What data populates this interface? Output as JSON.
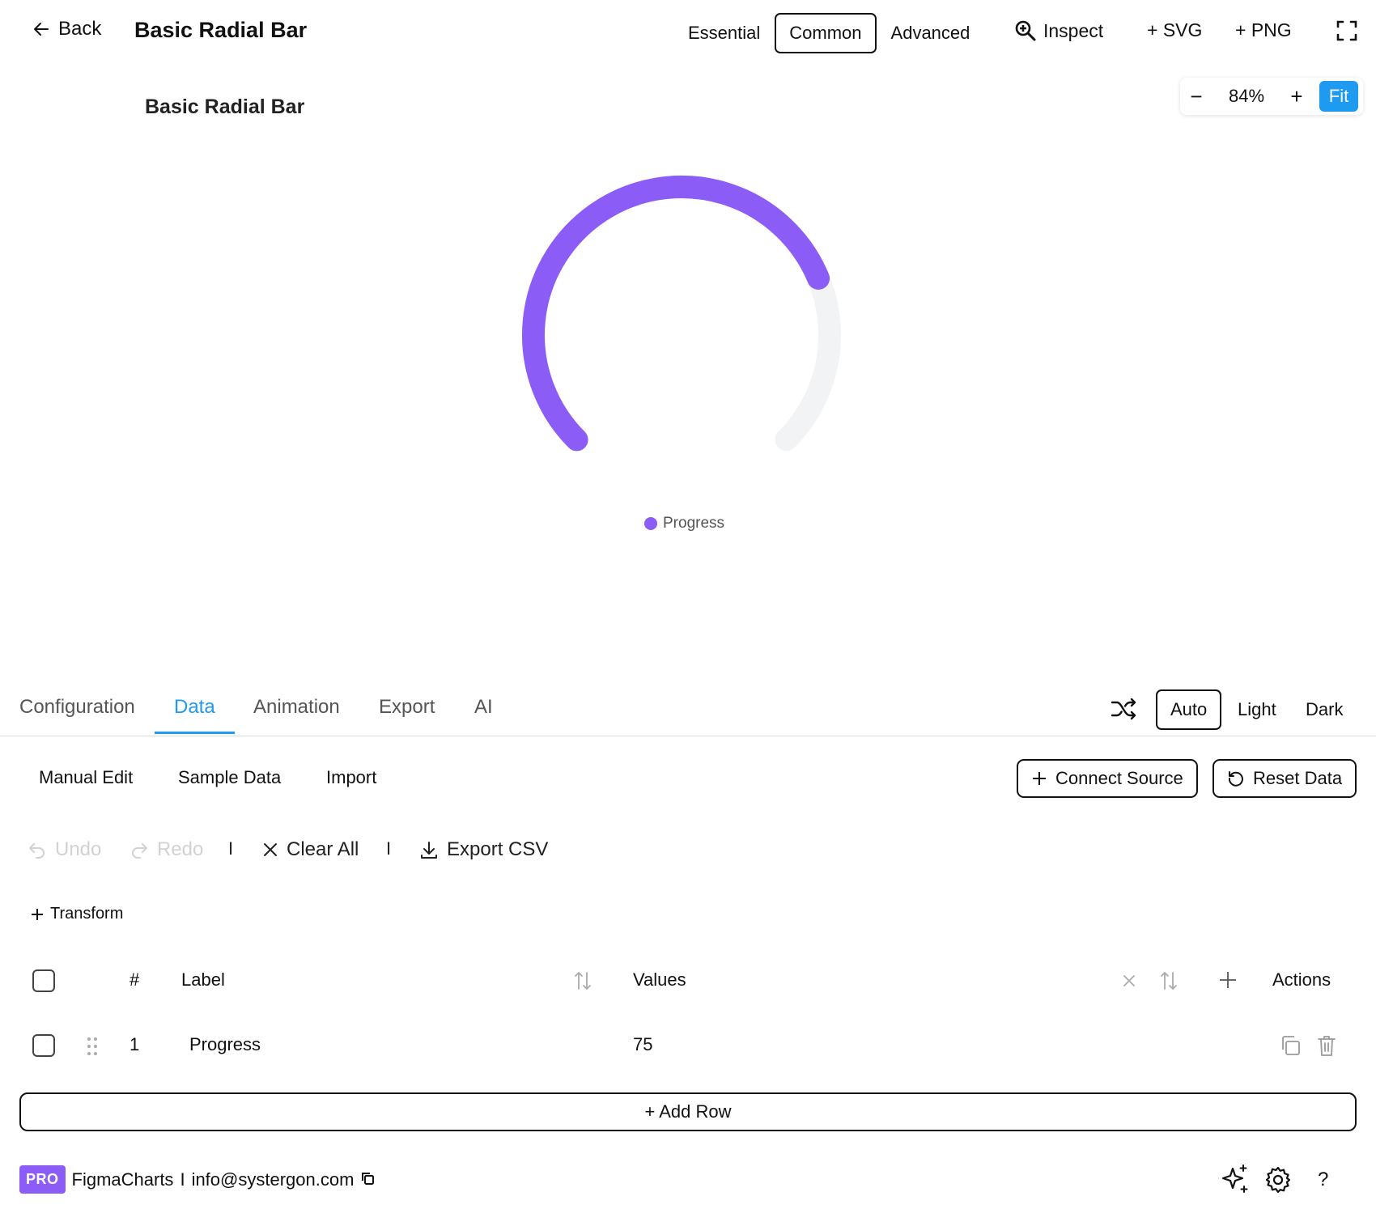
{
  "header": {
    "back_label": "Back",
    "title": "Basic Radial Bar",
    "category_tabs": [
      {
        "label": "Essential",
        "active": false
      },
      {
        "label": "Common",
        "active": true
      },
      {
        "label": "Advanced",
        "active": false
      }
    ],
    "inspect_label": "Inspect",
    "svg_label": "+ SVG",
    "png_label": "+ PNG"
  },
  "zoom": {
    "minus": "−",
    "level": "84%",
    "plus": "+",
    "fit_label": "Fit"
  },
  "colors": {
    "accent": "#1e9bf0",
    "series": "#8b5cf6",
    "track": "#f2f3f4"
  },
  "chart_data": {
    "type": "radial_bar",
    "title": "Basic Radial Bar",
    "categories": [
      "Progress"
    ],
    "values": [
      75
    ],
    "max": 100,
    "start_angle_deg": -135,
    "end_angle_deg": 135,
    "legend": [
      "Progress"
    ],
    "legend_position": "bottom"
  },
  "panel_tabs": [
    "Configuration",
    "Data",
    "Animation",
    "Export",
    "AI"
  ],
  "panel_active": "Data",
  "theme_tabs": [
    {
      "label": "Auto",
      "active": true
    },
    {
      "label": "Light",
      "active": false
    },
    {
      "label": "Dark",
      "active": false
    }
  ],
  "data_panel": {
    "sub_tabs": [
      "Manual Edit",
      "Sample Data",
      "Import"
    ],
    "connect_source": "Connect Source",
    "reset_data": "Reset Data",
    "toolbar": {
      "undo": "Undo",
      "redo": "Redo",
      "separator": "I",
      "clear_all": "Clear All",
      "export_csv": "Export CSV"
    },
    "transform": "Transform",
    "table": {
      "headers": {
        "index": "#",
        "label": "Label",
        "values": "Values",
        "actions": "Actions"
      },
      "rows": [
        {
          "index": "1",
          "label": "Progress",
          "value": "75"
        }
      ]
    },
    "add_row": "+ Add Row"
  },
  "footer": {
    "badge": "PRO",
    "brand": "FigmaCharts",
    "separator": "I",
    "email": "info@systergon.com",
    "help": "?"
  }
}
